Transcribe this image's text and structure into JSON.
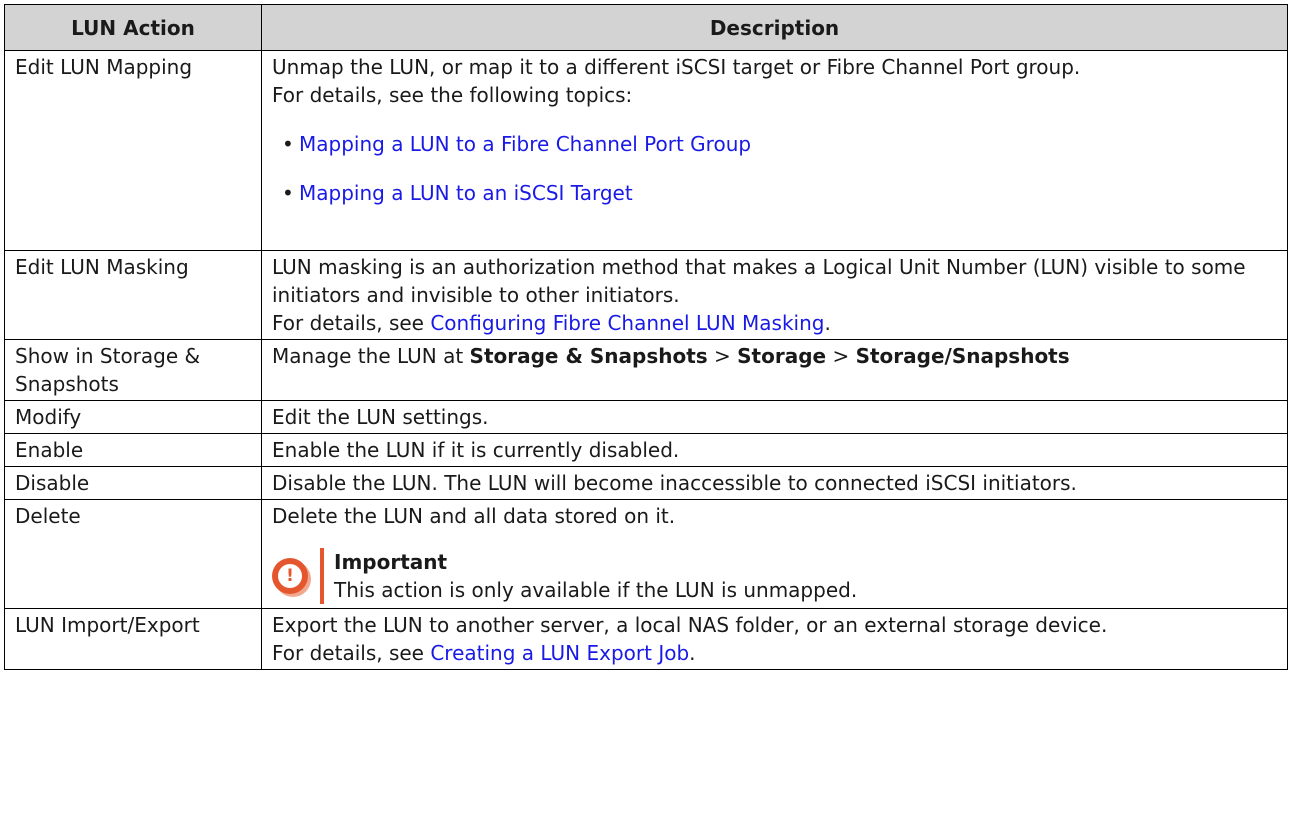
{
  "headers": [
    "LUN Action",
    "Description"
  ],
  "rows": {
    "edit_mapping": {
      "action": "Edit LUN Mapping",
      "desc1": "Unmap the LUN, or map it to a different iSCSI target or Fibre Channel Port group.",
      "desc2": "For details, see the following topics:",
      "link1": "Mapping a LUN to a Fibre Channel Port Group",
      "link2": "Mapping a LUN to an iSCSI Target",
      "bullet": "•"
    },
    "edit_masking": {
      "action": "Edit LUN Masking",
      "desc1": "LUN masking is an authorization method that makes a Logical Unit Number (LUN) visible to some initiators and invisible to other initiators.",
      "desc2_prefix": "For details, see ",
      "link": "Configuring Fibre Channel LUN Masking",
      "desc2_suffix": "."
    },
    "show_storage": {
      "action": "Show in Storage & Snapshots",
      "prefix": "Manage the LUN at ",
      "b1": "Storage & Snapshots",
      "sep1": " > ",
      "b2": "Storage",
      "sep2": " > ",
      "b3": "Storage/Snapshots"
    },
    "modify": {
      "action": "Modify",
      "desc": "Edit the LUN settings."
    },
    "enable": {
      "action": "Enable",
      "desc": "Enable the LUN if it is currently disabled."
    },
    "disable": {
      "action": "Disable",
      "desc": "Disable the LUN. The LUN will become inaccessible to connected iSCSI initiators."
    },
    "delete": {
      "action": "Delete",
      "desc": "Delete the LUN and all data stored on it.",
      "note_title": "Important",
      "note_text": "This action is only available if the LUN is unmapped.",
      "note_glyph": "!"
    },
    "import_export": {
      "action": "LUN Import/Export",
      "desc1": "Export the LUN to another server, a local NAS folder, or an external storage device.",
      "desc2_prefix": "For details, see ",
      "link": "Creating a LUN Export Job",
      "desc2_suffix": "."
    }
  },
  "colors": {
    "header_bg": "#d3d3d3",
    "link": "#1a1ae6",
    "important": "#e4572e"
  }
}
